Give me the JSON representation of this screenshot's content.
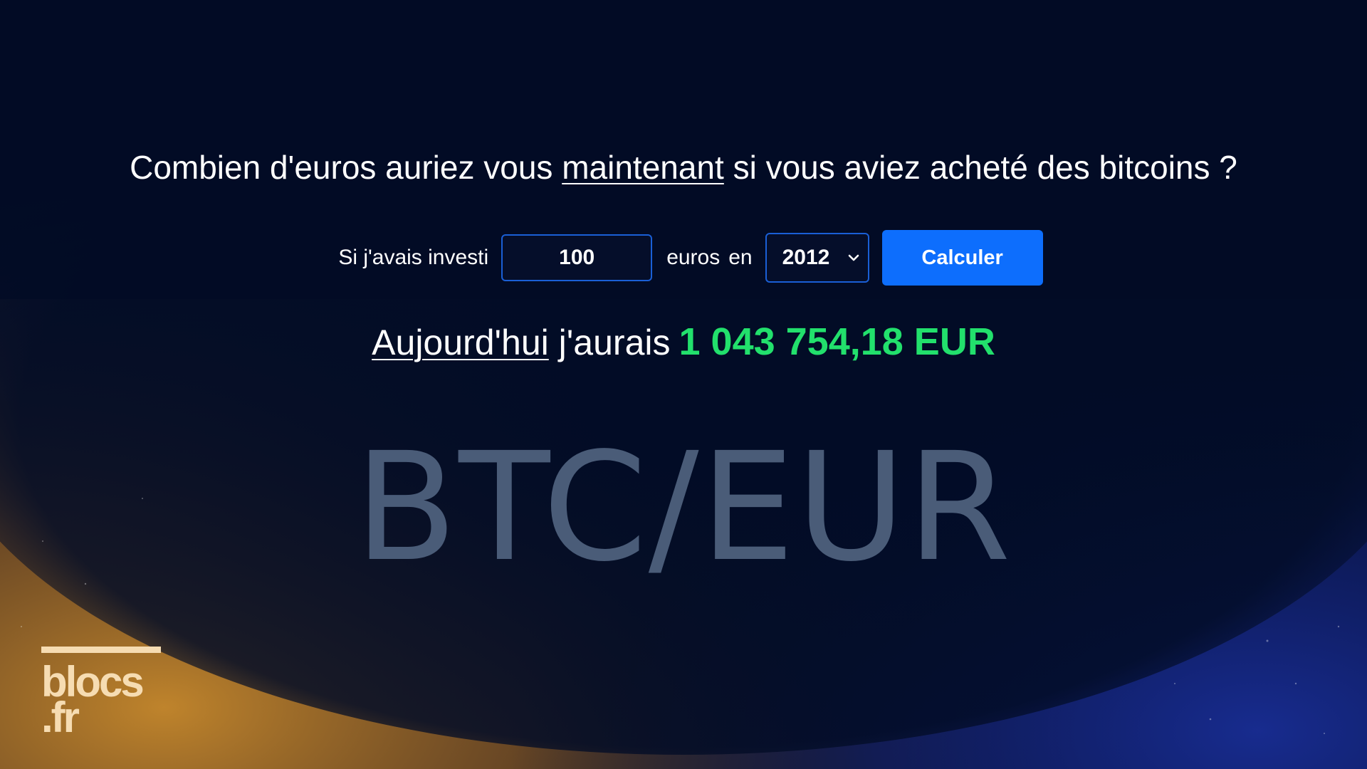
{
  "question": {
    "before": "Combien d'euros auriez vous ",
    "underlined": "maintenant",
    "after": " si vous aviez acheté des bitcoins ?"
  },
  "form": {
    "invest_label": "Si j'avais investi",
    "amount_value": "100",
    "euros_label": "euros",
    "en_label": "en",
    "year_selected": "2012",
    "calculate_label": "Calculer"
  },
  "result": {
    "today_label": "Aujourd'hui",
    "would_have_label": " j'aurais",
    "amount": "1 043 754,18 EUR"
  },
  "watermark": "BTC/EUR",
  "logo": {
    "line1": "blocs",
    "line2": ".fr"
  },
  "colors": {
    "background": "#020c26",
    "accent_button": "#0d6efd",
    "result_amount": "#22e06c",
    "input_border": "#1a5fd6",
    "watermark": "#4a5c78",
    "logo": "#f6dcb2"
  },
  "icons": {
    "select_arrow": "chevron-down-icon"
  }
}
